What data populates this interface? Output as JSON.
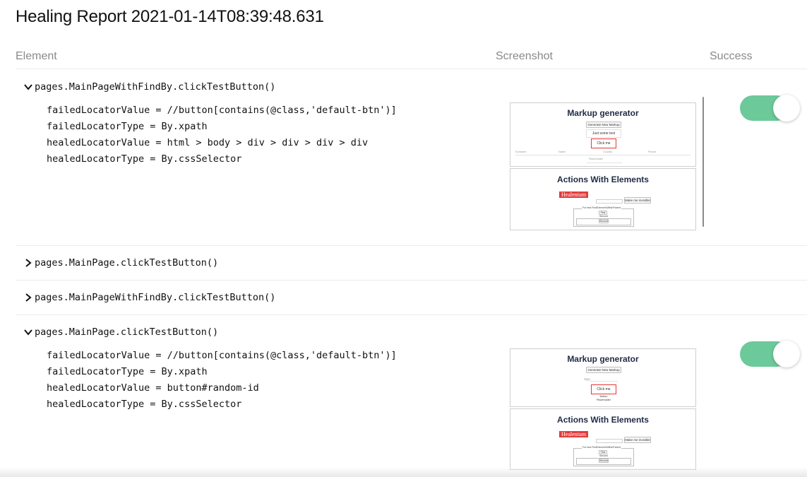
{
  "report": {
    "title": "Healing Report 2021-01-14T08:39:48.631"
  },
  "columns": {
    "element": "Element",
    "screenshot": "Screenshot",
    "success": "Success"
  },
  "colors": {
    "toggle_on": "#6cc99a",
    "highlight_border": "#e53935",
    "logo_bg": "#e23b3b"
  },
  "entries": [
    {
      "summary": "pages.MainPageWithFindBy.clickTestButton()",
      "expanded": true,
      "lines": [
        "failedLocatorValue = //button[contains(@class,'default-btn')]",
        "failedLocatorType = By.xpath",
        "healedLocatorValue = html > body > div > div > div > div",
        "healedLocatorType = By.cssSelector"
      ],
      "success": true,
      "screenshot": {
        "markup_title": "Markup generator",
        "generate_btn": "Generate New Markup",
        "some_text": "Just some text",
        "click_me": "Click me",
        "table_headers": [
          "Surname",
          "Name",
          "Country",
          "Phone"
        ],
        "placeholder": "Placeholder",
        "actions_title": "Actions With Elements",
        "logo": "Healenium",
        "invisible_btn": "Make me invisible",
        "fieldset_legend": "For test FindElementWithinParent",
        "first": "First",
        "second_label": "Second",
        "second_btn": "Second"
      }
    },
    {
      "summary": "pages.MainPage.clickTestButton()",
      "expanded": false
    },
    {
      "summary": "pages.MainPageWithFindBy.clickTestButton()",
      "expanded": false
    },
    {
      "summary": "pages.MainPage.clickTestButton()",
      "expanded": true,
      "lines": [
        "failedLocatorValue = //button[contains(@class,'default-btn')]",
        "failedLocatorType = By.xpath",
        "healedLocatorValue = button#random-id",
        "healedLocatorType = By.cssSelector"
      ],
      "success": true,
      "screenshot": {
        "markup_title": "Markup generator",
        "generate_btn": "Generate New Markup",
        "sign": "Sign",
        "click_me": "Click me",
        "button_label": "Button",
        "placeholder": "Placeholder",
        "actions_title": "Actions With Elements",
        "logo": "Healenium",
        "invisible_btn": "Make me invisible",
        "fieldset_legend": "For test FindElementWithinParent",
        "first": "First",
        "second_label": "Second",
        "second_btn": "Second"
      }
    }
  ]
}
